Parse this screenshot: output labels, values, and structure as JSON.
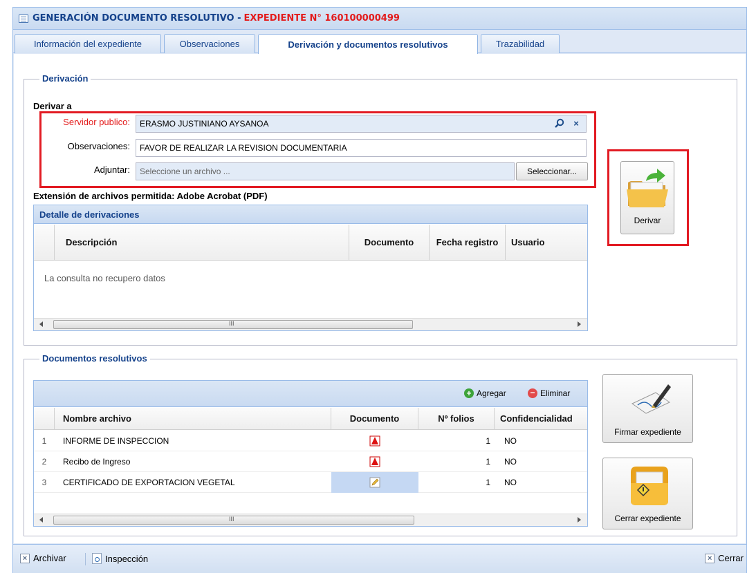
{
  "window": {
    "title": "GENERACIÓN DOCUMENTO RESOLUTIVO - ",
    "title_highlight": "EXPEDIENTE N° 160100000499"
  },
  "tabs": [
    {
      "label": "Información del expediente",
      "active": false
    },
    {
      "label": "Observaciones",
      "active": false
    },
    {
      "label": "Derivación y documentos resolutivos",
      "active": true
    },
    {
      "label": "Trazabilidad",
      "active": false
    }
  ],
  "derivacion": {
    "legend": "Derivación",
    "subheading": "Derivar a",
    "servidor_label": "Servidor publico:",
    "servidor_value": "ERASMO JUSTINIANO AYSANOA",
    "observaciones_label": "Observaciones:",
    "observaciones_value": "FAVOR DE REALIZAR LA REVISION DOCUMENTARIA",
    "adjuntar_label": "Adjuntar:",
    "adjuntar_placeholder": "Seleccione un archivo ...",
    "seleccionar_label": "Seleccionar...",
    "extension_note": "Extensión de archivos permitida: Adobe Acrobat (PDF)",
    "derivar_label": "Derivar",
    "detalle": {
      "title": "Detalle de derivaciones",
      "columns": [
        "Descripción",
        "Documento",
        "Fecha registro",
        "Usuario"
      ],
      "empty_text": "La consulta no recupero datos"
    }
  },
  "documentos": {
    "legend": "Documentos resolutivos",
    "agregar_label": "Agregar",
    "eliminar_label": "Eliminar",
    "columns": [
      "Nombre archivo",
      "Documento",
      "Nº folios",
      "Confidencialidad"
    ],
    "rows": [
      {
        "num": "1",
        "nombre": "INFORME DE INSPECCION",
        "doc_icon": "pdf-icon",
        "folios": "1",
        "conf": "NO"
      },
      {
        "num": "2",
        "nombre": "Recibo de Ingreso",
        "doc_icon": "pdf-icon",
        "folios": "1",
        "conf": "NO"
      },
      {
        "num": "3",
        "nombre": "CERTIFICADO DE EXPORTACION VEGETAL",
        "doc_icon": "edit-icon",
        "folios": "1",
        "conf": "NO"
      }
    ],
    "firmar_label": "Firmar expediente",
    "cerrar_label": "Cerrar expediente"
  },
  "footer": {
    "archivar_label": "Archivar",
    "inspeccion_label": "Inspección",
    "cerrar_label": "Cerrar"
  },
  "colors": {
    "accent": "#15428b",
    "highlight_red": "#e31c1c",
    "border_blue": "#99bbe8"
  }
}
